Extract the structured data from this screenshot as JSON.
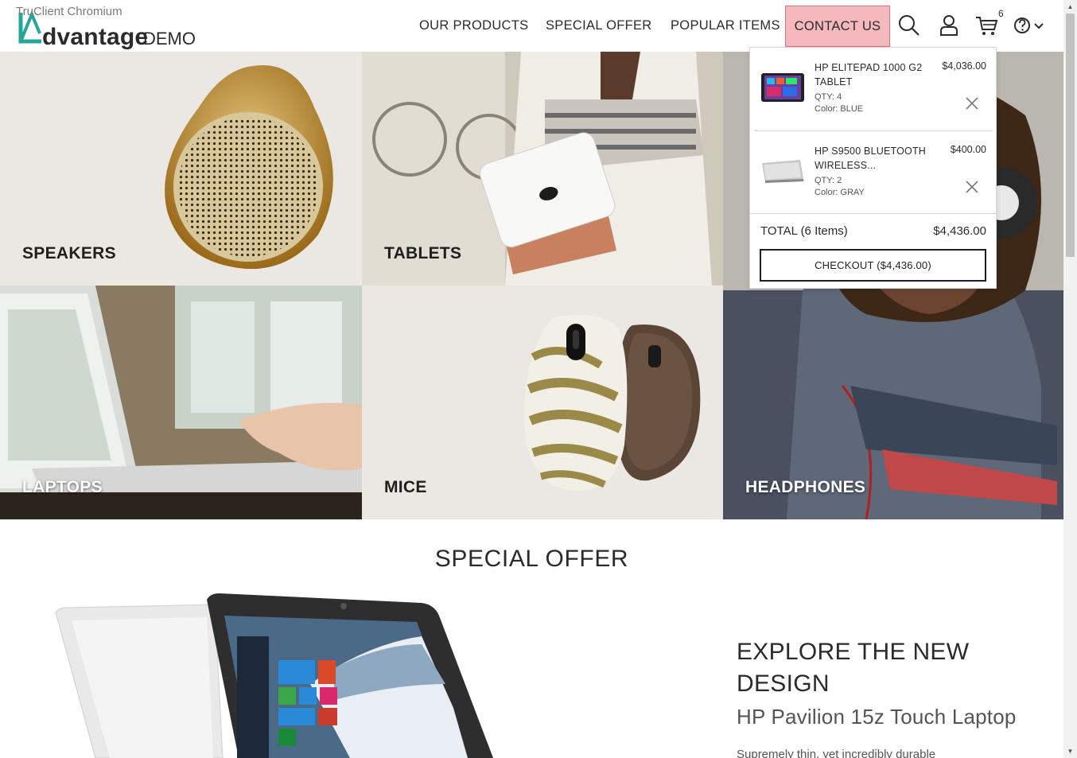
{
  "window": {
    "caption": "TruClient Chromium"
  },
  "brand": {
    "wordmark": "dvantage",
    "suffix": "DEMO",
    "accent": "#26a69a"
  },
  "nav": {
    "our_products": "OUR PRODUCTS",
    "special_offer": "SPECIAL OFFER",
    "popular_items": "POPULAR ITEMS",
    "contact_us": "CONTACT US",
    "cart_count": "6"
  },
  "icons": {
    "search": "search-icon",
    "user": "user-icon",
    "cart": "cart-icon",
    "help": "help-icon",
    "chevron": "chevron-down-icon",
    "remove": "close-icon"
  },
  "categories": {
    "speakers": "SPEAKERS",
    "tablets": "TABLETS",
    "laptops": "LAPTOPS",
    "mice": "MICE",
    "headphones": "HEADPHONES"
  },
  "cart": {
    "items": [
      {
        "name": "HP ELITEPAD 1000 G2 TABLET",
        "price": "$4,036.00",
        "qty": "QTY: 4",
        "color": "Color: BLUE"
      },
      {
        "name": "HP S9500 BLUETOOTH WIRELESS...",
        "price": "$400.00",
        "qty": "QTY: 2",
        "color": "Color: GRAY"
      }
    ],
    "total_label": "TOTAL (6 Items)",
    "total_value": "$4,436.00",
    "checkout_label": "CHECKOUT ($4,436.00)"
  },
  "special_offer": {
    "heading": "SPECIAL OFFER",
    "title": "EXPLORE THE NEW DESIGN",
    "subtitle": "HP Pavilion 15z Touch Laptop",
    "description": "Supremely thin, yet incredibly durable"
  },
  "colors": {
    "contact_highlight": "#f4b8bd",
    "text": "#2b2b2b"
  }
}
